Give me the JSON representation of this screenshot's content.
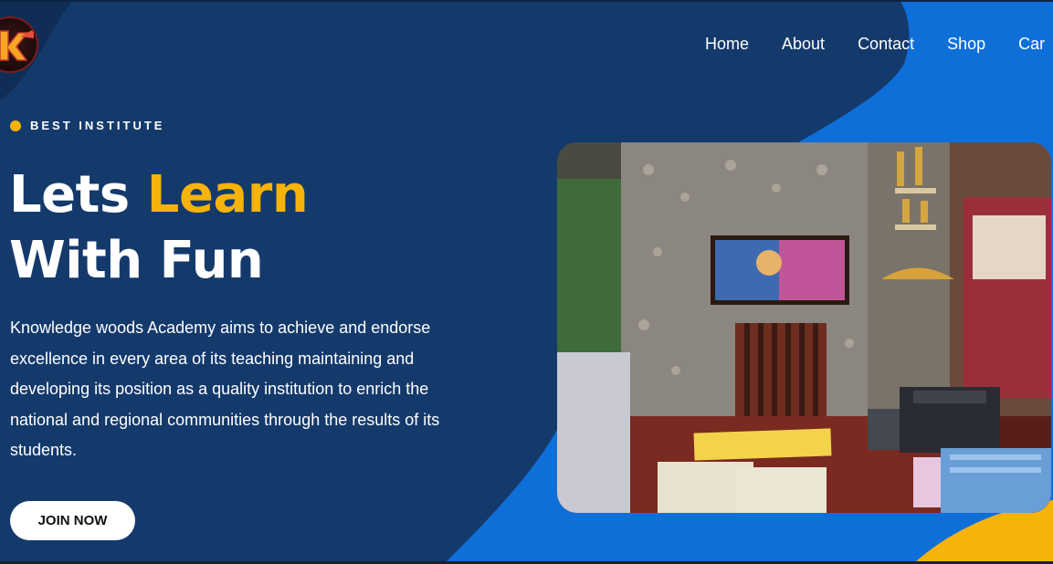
{
  "brand": {
    "logo_letter": "k"
  },
  "nav": {
    "items": [
      {
        "label": "Home"
      },
      {
        "label": "About"
      },
      {
        "label": "Contact"
      },
      {
        "label": "Shop"
      },
      {
        "label": "Car"
      }
    ]
  },
  "hero": {
    "eyebrow": "BEST INSTITUTE",
    "title_part1": "Lets ",
    "title_accent": "Learn",
    "title_line2": "With Fun",
    "description": "Knowledge woods Academy aims to achieve and endorse excellence in every area of its teaching maintaining and developing its position as a quality institution to enrich the national and regional communities through the results of its students.",
    "cta_label": "JOIN NOW"
  },
  "colors": {
    "background": "#143a6c",
    "accent_blue": "#0f6fd9",
    "accent_yellow": "#f5b30b",
    "text": "#ffffff"
  }
}
